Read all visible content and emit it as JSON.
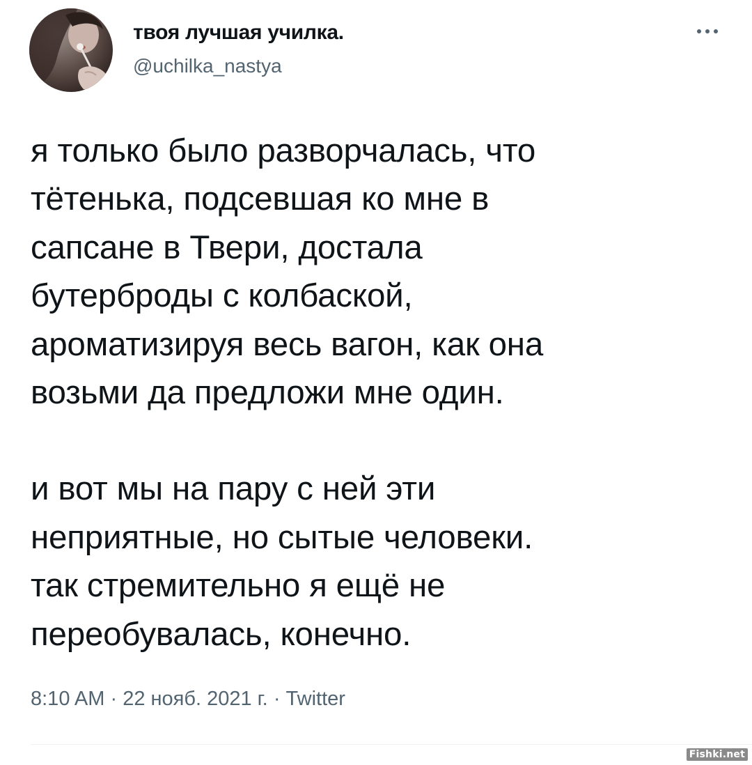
{
  "author": {
    "display_name": "твоя лучшая училка.",
    "handle": "@uchilka_nastya",
    "avatar": "profile-photo-avatar"
  },
  "tweet": {
    "paragraphs": [
      [
        "я только было разворчалась, что",
        "тётенька, подсевшая ко мне в",
        "сапсане в Твери, достала",
        "бутерброды с колбаской,",
        "ароматизируя весь вагон, как она",
        "возьми да предложи мне один."
      ],
      [
        "и вот мы на пару с ней эти",
        "неприятные, но сытые человеки.",
        "так стремительно я ещё не",
        "переобувалась, конечно."
      ]
    ]
  },
  "meta": {
    "time": "8:10 AM",
    "date": "22 нояб. 2021 г.",
    "source": "Twitter",
    "separator": "·"
  },
  "icons": {
    "more": "more-options-icon"
  },
  "watermark": "Fishki.net",
  "colors": {
    "text": "#0f1419",
    "secondary": "#536471",
    "divider": "#eff3f4"
  }
}
